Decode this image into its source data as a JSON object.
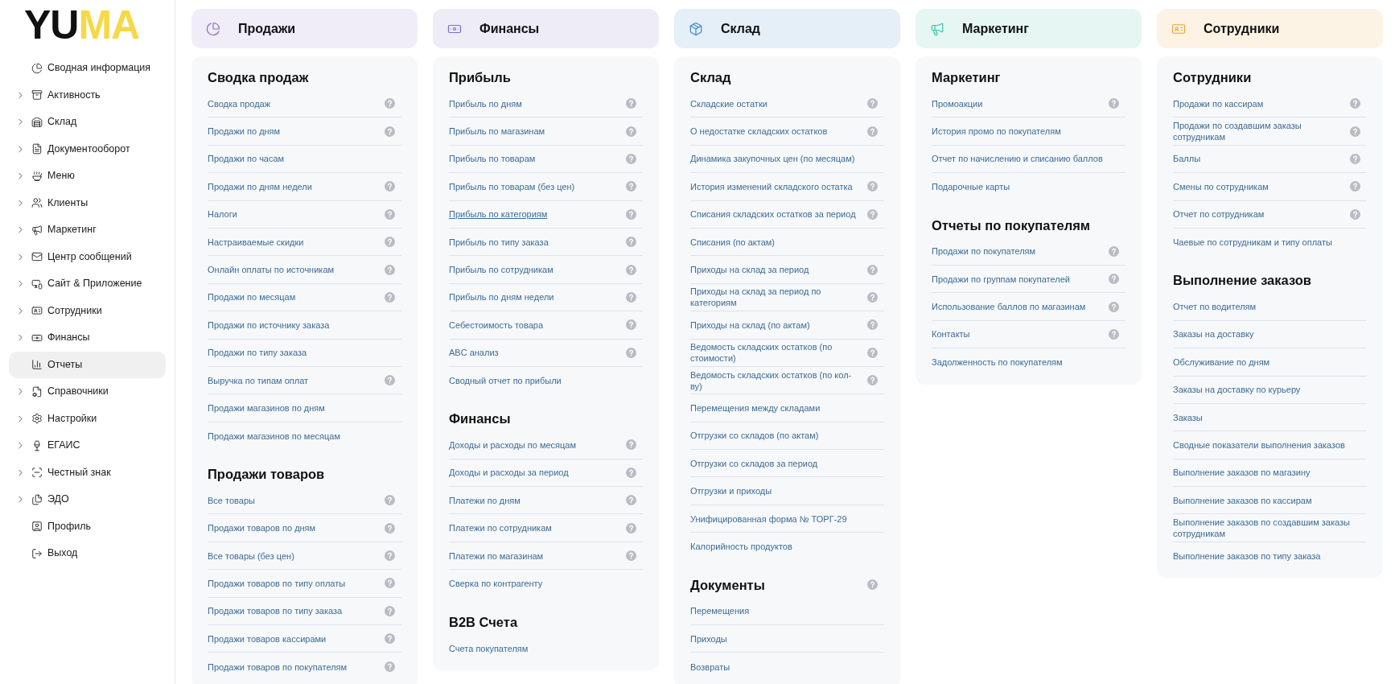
{
  "logo": [
    {
      "text": "YU",
      "color": "#111111"
    },
    {
      "text": "MA",
      "color": "#f6d848"
    }
  ],
  "sidebar": {
    "items": [
      {
        "label": "Сводная информация",
        "expandable": false,
        "selected": false
      },
      {
        "label": "Активность",
        "expandable": true,
        "selected": false
      },
      {
        "label": "Склад",
        "expandable": true,
        "selected": false
      },
      {
        "label": "Документооборот",
        "expandable": true,
        "selected": false
      },
      {
        "label": "Меню",
        "expandable": true,
        "selected": false
      },
      {
        "label": "Клиенты",
        "expandable": true,
        "selected": false
      },
      {
        "label": "Маркетинг",
        "expandable": true,
        "selected": false
      },
      {
        "label": "Центр сообщений",
        "expandable": true,
        "selected": false
      },
      {
        "label": "Сайт & Приложение",
        "expandable": true,
        "selected": false
      },
      {
        "label": "Сотрудники",
        "expandable": true,
        "selected": false
      },
      {
        "label": "Финансы",
        "expandable": true,
        "selected": false
      },
      {
        "label": "Отчеты",
        "expandable": false,
        "selected": true
      },
      {
        "label": "Справочники",
        "expandable": true,
        "selected": false
      },
      {
        "label": "Настройки",
        "expandable": true,
        "selected": false
      },
      {
        "label": "ЕГАИС",
        "expandable": true,
        "selected": false
      },
      {
        "label": "Честный знак",
        "expandable": true,
        "selected": false
      },
      {
        "label": "ЭДО",
        "expandable": true,
        "selected": false
      },
      {
        "label": "Профиль",
        "expandable": false,
        "selected": false
      },
      {
        "label": "Выход",
        "expandable": false,
        "selected": false
      }
    ]
  },
  "columns": [
    {
      "title": "Продажи",
      "color": "#8b6fc9",
      "sections": [
        {
          "title": "Сводка продаж",
          "help": false,
          "items": [
            {
              "label": "Сводка продаж",
              "help": true,
              "hovered": false
            },
            {
              "label": "Продажи по дням",
              "help": true,
              "hovered": false
            },
            {
              "label": "Продажи по часам",
              "help": false,
              "hovered": false
            },
            {
              "label": "Продажи по дням недели",
              "help": true,
              "hovered": false
            },
            {
              "label": "Налоги",
              "help": true,
              "hovered": false
            },
            {
              "label": "Настраиваемые скидки",
              "help": true,
              "hovered": false
            },
            {
              "label": "Онлайн оплаты по источникам",
              "help": true,
              "hovered": false
            },
            {
              "label": "Продажи по месяцам",
              "help": true,
              "hovered": false
            },
            {
              "label": "Продажи по источнику заказа",
              "help": false,
              "hovered": false
            },
            {
              "label": "Продажи по типу заказа",
              "help": false,
              "hovered": false
            },
            {
              "label": "Выручка по типам оплат",
              "help": true,
              "hovered": false
            },
            {
              "label": "Продажи магазинов по дням",
              "help": false,
              "hovered": false
            },
            {
              "label": "Продажи магазинов по месяцам",
              "help": false,
              "hovered": false
            }
          ]
        },
        {
          "title": "Продажи товаров",
          "help": false,
          "items": [
            {
              "label": "Все товары",
              "help": true,
              "hovered": false
            },
            {
              "label": "Продажи товаров по дням",
              "help": true,
              "hovered": false
            },
            {
              "label": "Все товары (без цен)",
              "help": true,
              "hovered": false
            },
            {
              "label": "Продажи товаров по типу оплаты",
              "help": true,
              "hovered": false
            },
            {
              "label": "Продажи товаров по типу заказа",
              "help": true,
              "hovered": false
            },
            {
              "label": "Продажи товаров кассирами",
              "help": true,
              "hovered": false
            },
            {
              "label": "Продажи товаров по покупателям",
              "help": true,
              "hovered": false
            }
          ]
        }
      ]
    },
    {
      "title": "Финансы",
      "color": "#7770c4",
      "sections": [
        {
          "title": "Прибыль",
          "help": false,
          "items": [
            {
              "label": "Прибыль по дням",
              "help": true,
              "hovered": false
            },
            {
              "label": "Прибыль по магазинам",
              "help": true,
              "hovered": false
            },
            {
              "label": "Прибыль по товарам",
              "help": true,
              "hovered": false
            },
            {
              "label": "Прибыль по товарам (без цен)",
              "help": true,
              "hovered": false
            },
            {
              "label": "Прибыль по категориям",
              "help": true,
              "hovered": true
            },
            {
              "label": "Прибыль по типу заказа",
              "help": true,
              "hovered": false
            },
            {
              "label": "Прибыль по сотрудникам",
              "help": true,
              "hovered": false
            },
            {
              "label": "Прибыль по дням недели",
              "help": true,
              "hovered": false
            },
            {
              "label": "Себестоимость товара",
              "help": true,
              "hovered": false
            },
            {
              "label": "ABC анализ",
              "help": true,
              "hovered": false
            },
            {
              "label": "Сводный отчет по прибыли",
              "help": false,
              "hovered": false
            }
          ]
        },
        {
          "title": "Финансы",
          "help": false,
          "items": [
            {
              "label": "Доходы и расходы по месяцам",
              "help": true,
              "hovered": false
            },
            {
              "label": "Доходы и расходы за период",
              "help": true,
              "hovered": false
            },
            {
              "label": "Платежи по дням",
              "help": true,
              "hovered": false
            },
            {
              "label": "Платежи по сотрудникам",
              "help": true,
              "hovered": false
            },
            {
              "label": "Платежи по магазинам",
              "help": true,
              "hovered": false
            },
            {
              "label": "Сверка по контрагенту",
              "help": false,
              "hovered": false
            }
          ]
        },
        {
          "title": "B2B Счета",
          "help": false,
          "items": [
            {
              "label": "Счета покупателям",
              "help": false,
              "hovered": false
            }
          ]
        }
      ]
    },
    {
      "title": "Склад",
      "color": "#3a88c8",
      "sections": [
        {
          "title": "Склад",
          "help": false,
          "items": [
            {
              "label": "Складские остатки",
              "help": true,
              "hovered": false
            },
            {
              "label": "О недостатке складских остатков",
              "help": true,
              "hovered": false
            },
            {
              "label": "Динамика закупочных цен (по месяцам)",
              "help": false,
              "hovered": false
            },
            {
              "label": "История изменений складского остатка",
              "help": true,
              "hovered": false
            },
            {
              "label": "Списания складских остатков за период",
              "help": true,
              "hovered": false
            },
            {
              "label": "Списания (по актам)",
              "help": false,
              "hovered": false
            },
            {
              "label": "Приходы на склад за период",
              "help": true,
              "hovered": false
            },
            {
              "label": "Приходы на склад за период по категориям",
              "help": true,
              "hovered": false
            },
            {
              "label": "Приходы на склад (по актам)",
              "help": true,
              "hovered": false
            },
            {
              "label": "Ведомость складских остатков (по стоимости)",
              "help": true,
              "hovered": false
            },
            {
              "label": "Ведомость складских остатков (по кол-ву)",
              "help": true,
              "hovered": false
            },
            {
              "label": "Перемещения между складами",
              "help": false,
              "hovered": false
            },
            {
              "label": "Отгрузки со складов (по актам)",
              "help": false,
              "hovered": false
            },
            {
              "label": "Отгрузки со складов за период",
              "help": false,
              "hovered": false
            },
            {
              "label": "Отгрузки и приходы",
              "help": false,
              "hovered": false
            },
            {
              "label": "Унифицированная форма № ТОРГ-29",
              "help": false,
              "hovered": false
            },
            {
              "label": "Калорийность продуктов",
              "help": false,
              "hovered": false
            }
          ]
        },
        {
          "title": "Документы",
          "help": true,
          "items": [
            {
              "label": "Перемещения",
              "help": false,
              "hovered": false
            },
            {
              "label": "Приходы",
              "help": false,
              "hovered": false
            },
            {
              "label": "Возвраты",
              "help": false,
              "hovered": false
            }
          ]
        }
      ]
    },
    {
      "title": "Маркетинг",
      "color": "#3dbfa6",
      "sections": [
        {
          "title": "Маркетинг",
          "help": false,
          "items": [
            {
              "label": "Промоакции",
              "help": true,
              "hovered": false
            },
            {
              "label": "История промо по покупателям",
              "help": false,
              "hovered": false
            },
            {
              "label": "Отчет по начислению и списанию баллов",
              "help": false,
              "hovered": false
            },
            {
              "label": "Подарочные карты",
              "help": false,
              "hovered": false
            }
          ]
        },
        {
          "title": "Отчеты по покупателям",
          "help": false,
          "items": [
            {
              "label": "Продажи по покупателям",
              "help": true,
              "hovered": false
            },
            {
              "label": "Продажи по группам покупателей",
              "help": true,
              "hovered": false
            },
            {
              "label": "Использование баллов по магазинам",
              "help": true,
              "hovered": false
            },
            {
              "label": "Контакты",
              "help": true,
              "hovered": false
            },
            {
              "label": "Задолженность по покупателям",
              "help": false,
              "hovered": false
            }
          ]
        }
      ]
    },
    {
      "title": "Сотрудники",
      "color": "#e9a23e",
      "sections": [
        {
          "title": "Сотрудники",
          "help": false,
          "items": [
            {
              "label": "Продажи по кассирам",
              "help": true,
              "hovered": false
            },
            {
              "label": "Продажи по создавшим заказы сотрудникам",
              "help": true,
              "hovered": false
            },
            {
              "label": "Баллы",
              "help": true,
              "hovered": false
            },
            {
              "label": "Смены по сотрудникам",
              "help": true,
              "hovered": false
            },
            {
              "label": "Отчет по сотрудникам",
              "help": true,
              "hovered": false
            },
            {
              "label": "Чаевые по сотрудникам и типу оплаты",
              "help": false,
              "hovered": false
            }
          ]
        },
        {
          "title": "Выполнение заказов",
          "help": false,
          "items": [
            {
              "label": "Отчет по водителям",
              "help": false,
              "hovered": false
            },
            {
              "label": "Заказы на доставку",
              "help": false,
              "hovered": false
            },
            {
              "label": "Обслуживание по дням",
              "help": false,
              "hovered": false
            },
            {
              "label": "Заказы на доставку по курьеру",
              "help": false,
              "hovered": false
            },
            {
              "label": "Заказы",
              "help": false,
              "hovered": false
            },
            {
              "label": "Сводные показатели выполнения заказов",
              "help": false,
              "hovered": false
            },
            {
              "label": "Выполнение заказов по магазину",
              "help": false,
              "hovered": false
            },
            {
              "label": "Выполнение заказов по кассирам",
              "help": false,
              "hovered": false
            },
            {
              "label": "Выполнение заказов по создавшим заказы сотрудникам",
              "help": false,
              "hovered": false
            },
            {
              "label": "Выполнение заказов по типу заказа",
              "help": false,
              "hovered": false
            }
          ]
        }
      ]
    }
  ]
}
